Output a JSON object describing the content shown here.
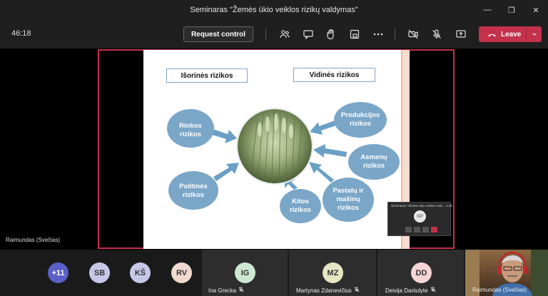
{
  "window": {
    "title": "Seminaras \"Žemės ūkio veiklos rizikų valdymas\""
  },
  "toolbar": {
    "timer": "46:18",
    "request_control_label": "Request control",
    "leave_label": "Leave",
    "icons": [
      "people-icon",
      "chat-icon",
      "raise-hand-icon",
      "rooms-icon",
      "more-icon",
      "camera-off-icon",
      "mic-off-icon",
      "share-icon"
    ]
  },
  "slide": {
    "left_header": "Išorinės rizikos",
    "right_header": "Vidinės rizikos",
    "bubbles": [
      {
        "label": "Rinkos rizikos"
      },
      {
        "label": "Politinės rizikos"
      },
      {
        "label": "Kitos rizikos"
      },
      {
        "label": "Produkcijos rizikos"
      },
      {
        "label": "Asmenų rizikos"
      },
      {
        "label": "Pastatų ir mašinų rizikos"
      }
    ],
    "colors": {
      "bubble": "#7aa6c8",
      "arrow": "#6b9fc6"
    }
  },
  "stage": {
    "presenter_label": "Raimundas (Svečias)",
    "mini_window_title": "Seminaras \"Žemės ūkio veiklos rizik...   4:18",
    "mini_avatar": "GP"
  },
  "participants": [
    {
      "initials": "+11",
      "bg": "#5b5fc7",
      "fg": "#ffffff",
      "name": ""
    },
    {
      "initials": "SB",
      "bg": "#c7c8e8",
      "fg": "#333333",
      "name": ""
    },
    {
      "initials": "KŠ",
      "bg": "#c7c8e8",
      "fg": "#333333",
      "name": ""
    },
    {
      "initials": "RV",
      "bg": "#f1d9cf",
      "fg": "#333333",
      "name": ""
    },
    {
      "initials": "IG",
      "bg": "#cfe7d3",
      "fg": "#333333",
      "name": "Ina Grecka"
    },
    {
      "initials": "MZ",
      "bg": "#e6e5c4",
      "fg": "#333333",
      "name": "Martynas Zdanevičius"
    },
    {
      "initials": "DD",
      "bg": "#f4d4d4",
      "fg": "#333333",
      "name": "Deivija Daniulyte"
    },
    {
      "initials": "",
      "bg": "",
      "fg": "",
      "name": "Raimundas (Svečias)"
    }
  ]
}
